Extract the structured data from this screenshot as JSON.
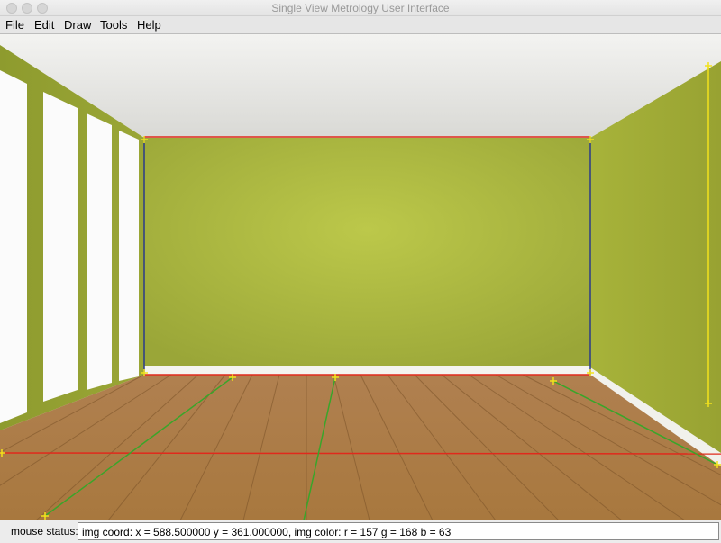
{
  "window": {
    "title": "Single View Metrology User Interface"
  },
  "menu": {
    "file": "File",
    "edit": "Edit",
    "draw": "Draw",
    "tools": "Tools",
    "help": "Help"
  },
  "status": {
    "label": "mouse status:",
    "value": "img coord: x = 588.500000 y = 361.000000, img color: r = 157 g = 168 b = 63"
  },
  "colors": {
    "wall": "#a9b63a",
    "floor": "#b8894f",
    "ceiling": "#e9e9e6",
    "line_red": "#e02a1c",
    "line_blue": "#2a3a8a",
    "line_green": "#3aa52a",
    "marker_yellow": "#f2e21c"
  },
  "icons": {
    "close": "traffic-light-close-icon",
    "minimize": "traffic-light-minimize-icon",
    "zoom": "traffic-light-zoom-icon"
  }
}
